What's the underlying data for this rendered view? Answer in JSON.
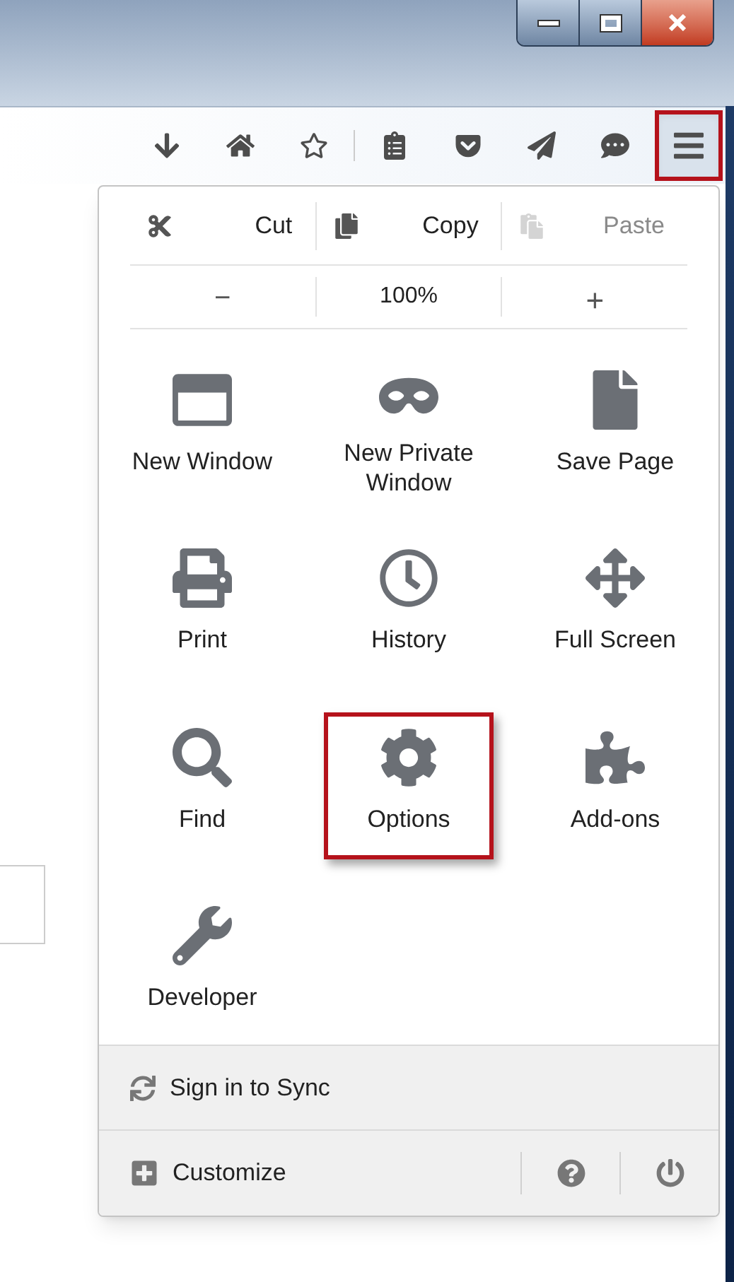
{
  "window_controls": [
    {
      "kind": "minimize"
    },
    {
      "kind": "maximize"
    },
    {
      "kind": "close"
    }
  ],
  "toolbar": {
    "buttons": [
      {
        "kind": "download",
        "highlighted": false
      },
      {
        "kind": "home",
        "highlighted": false
      },
      {
        "kind": "bookmark",
        "highlighted": false
      },
      {
        "kind": "reading-list",
        "highlighted": false
      },
      {
        "kind": "pocket",
        "highlighted": false
      },
      {
        "kind": "send",
        "highlighted": false
      },
      {
        "kind": "chat",
        "highlighted": false
      },
      {
        "kind": "menu",
        "highlighted": true
      }
    ]
  },
  "menu": {
    "edit_row": [
      {
        "label": "Cut",
        "disabled": false
      },
      {
        "label": "Copy",
        "disabled": false
      },
      {
        "label": "Paste",
        "disabled": true
      }
    ],
    "zoom_row": {
      "decrease": "−",
      "level": "100%",
      "increase": "+"
    },
    "items": [
      {
        "label": "New Window",
        "highlighted": false
      },
      {
        "label": "New Private Window",
        "highlighted": false
      },
      {
        "label": "Save Page",
        "highlighted": false
      },
      {
        "label": "Print",
        "highlighted": false
      },
      {
        "label": "History",
        "highlighted": false
      },
      {
        "label": "Full Screen",
        "highlighted": false
      },
      {
        "label": "Find",
        "highlighted": false
      },
      {
        "label": "Options",
        "highlighted": true
      },
      {
        "label": "Add-ons",
        "highlighted": false
      },
      {
        "label": "Developer",
        "highlighted": false
      }
    ],
    "sync": {
      "label": "Sign in to Sync"
    },
    "footer": {
      "customize": "Customize"
    }
  }
}
